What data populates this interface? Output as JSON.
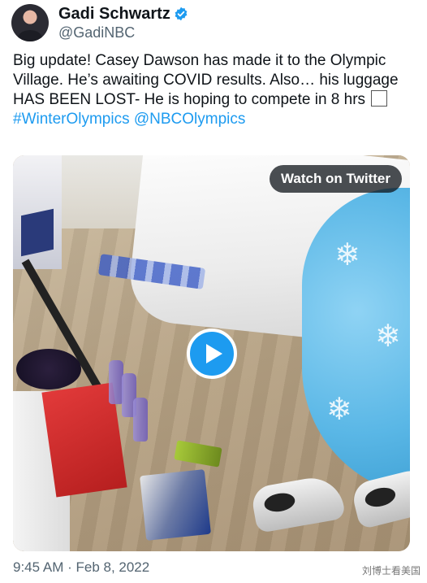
{
  "author": {
    "display_name": "Gadi Schwartz",
    "handle": "@GadiNBC",
    "verified": true,
    "verified_icon": "verified-badge-icon"
  },
  "tweet": {
    "text_main": "Big update! Casey Dawson has made it to the Olympic Village. He’s awaiting COVID results. Also… his luggage HAS BEEN LOST- He is hoping to compete in 8 hrs",
    "hashtag": "#WinterOlympics",
    "mention": "@NBCOlympics",
    "link_color": "#1d9bf0"
  },
  "media": {
    "watch_label": "Watch on Twitter",
    "play_icon": "play-icon",
    "accent": "#1d9bf0"
  },
  "footer": {
    "timestamp": "9:45 AM · Feb 8, 2022",
    "watermark": "刘博士看美国"
  }
}
